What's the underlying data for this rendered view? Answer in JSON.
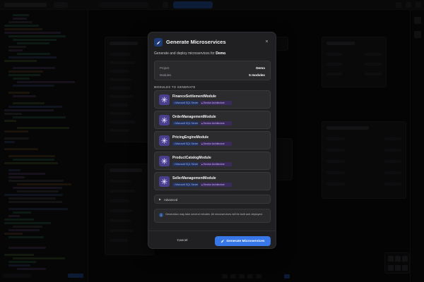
{
  "modal": {
    "title": "Generate Microservices",
    "close_glyph": "×",
    "description_prefix": "Generate and deploy microservices for",
    "project_name": "Demo",
    "description_suffix": ".",
    "info": {
      "project_label": "Project",
      "project_value": "Demo",
      "modules_label": "Modules",
      "modules_value": "5 modules"
    },
    "section_label": "MODULES TO GENERATE",
    "modules": [
      {
        "name": "FinanceSettlementModule",
        "db_tag": "Microsoft SQL Server",
        "arch_tag": "Service Architecture"
      },
      {
        "name": "OrderManagementModule",
        "db_tag": "Microsoft SQL Server",
        "arch_tag": "Service Architecture"
      },
      {
        "name": "PricingEngineModule",
        "db_tag": "Microsoft SQL Server",
        "arch_tag": "Service Architecture"
      },
      {
        "name": "ProductCatalogModule",
        "db_tag": "Microsoft SQL Server",
        "arch_tag": "Service Architecture"
      },
      {
        "name": "SellerManagementModule",
        "db_tag": "Microsoft SQL Server",
        "arch_tag": "Service Architecture"
      }
    ],
    "advanced_label": "Advanced",
    "notice": "Generation may take several minutes. All microservices will be built and deployed.",
    "cancel_label": "Cancel",
    "generate_label": "Generate Microservices"
  },
  "icons": {
    "title_icon": "rocket-icon",
    "module_icon": "component-icon",
    "db_tag_icon": "database-icon",
    "arch_tag_icon": "layers-icon",
    "advanced_icon": "chevron-right-icon",
    "notice_icon": "info-icon",
    "generate_icon": "rocket-icon"
  },
  "colors": {
    "accent": "#3877e8",
    "modal_bg": "#202022",
    "db_tag_bg": "#22315e",
    "arch_tag_bg": "#3b2a5c",
    "module_icon_bg": "#4a3f8c"
  }
}
